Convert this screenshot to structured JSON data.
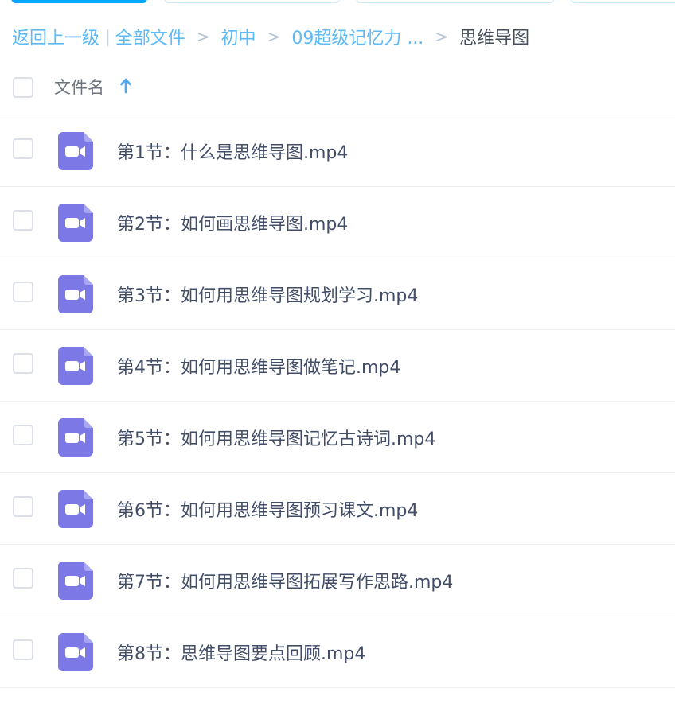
{
  "breadcrumb": {
    "back_label": "返回上一级",
    "items": [
      "全部文件",
      "初中",
      "09超级记忆力 ..."
    ],
    "separator": ">",
    "current": "思维导图"
  },
  "list_header": {
    "column_label": "文件名",
    "sort": "ascending",
    "sort_icon": "arrow-up-icon"
  },
  "file_icon": "video-file-icon",
  "files": [
    {
      "name": "第1节：什么是思维导图.mp4"
    },
    {
      "name": "第2节：如何画思维导图.mp4"
    },
    {
      "name": "第3节：如何用思维导图规划学习.mp4"
    },
    {
      "name": "第4节：如何用思维导图做笔记.mp4"
    },
    {
      "name": "第5节：如何用思维导图记忆古诗词.mp4"
    },
    {
      "name": "第6节：如何用思维导图预习课文.mp4"
    },
    {
      "name": "第7节：如何用思维导图拓展写作思路.mp4"
    },
    {
      "name": "第8节：思维导图要点回顾.mp4"
    }
  ],
  "colors": {
    "link": "#5fb9f4",
    "primary": "#06a7ff",
    "video_icon": "#7c79e6",
    "text": "#424e67"
  }
}
